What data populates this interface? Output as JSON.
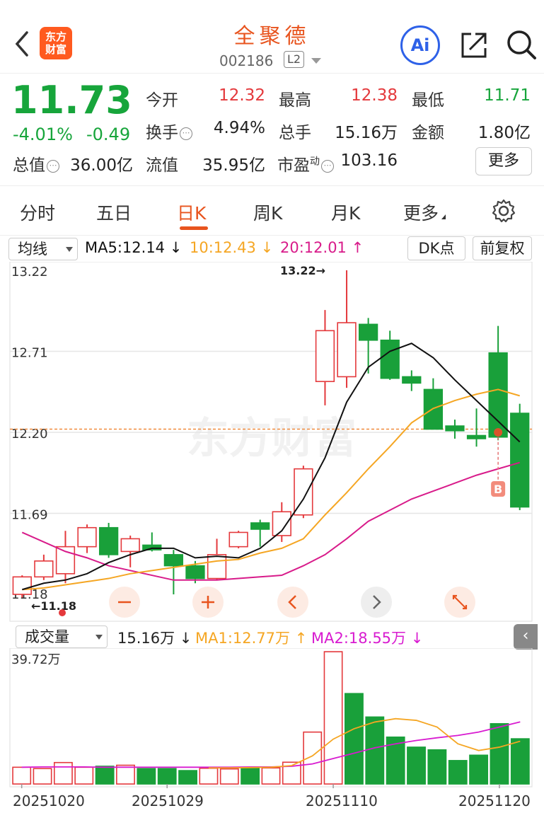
{
  "header": {
    "back_icon": "chevron-left-icon",
    "logo_text": "东方\n财富",
    "stock_name": "全聚德",
    "stock_code": "002186",
    "level_badge": "L2",
    "ai_label": "Ai"
  },
  "quote": {
    "price": "11.73",
    "change_pct": "-4.01%",
    "change_abs": "-0.49",
    "fields": [
      {
        "label": "今开",
        "value": "12.32",
        "color": "#e4393c"
      },
      {
        "label": "最高",
        "value": "12.38",
        "color": "#e4393c"
      },
      {
        "label": "最低",
        "value": "11.71",
        "color": "#17a53b"
      },
      {
        "label": "换手",
        "value": "4.94%",
        "color": "#222222"
      },
      {
        "label": "总手",
        "value": "15.16万",
        "color": "#222222"
      },
      {
        "label": "金额",
        "value": "1.80亿",
        "color": "#222222"
      },
      {
        "label": "总值",
        "value": "36.00亿",
        "color": "#222222"
      },
      {
        "label": "流值",
        "value": "35.95亿",
        "color": "#222222"
      },
      {
        "label": "市盈",
        "value": "103.16",
        "color": "#222222"
      }
    ],
    "pe_superscript": "动",
    "more_label": "更多"
  },
  "tabs": [
    {
      "label": "分时"
    },
    {
      "label": "五日"
    },
    {
      "label": "日K",
      "active": true
    },
    {
      "label": "周K"
    },
    {
      "label": "月K"
    },
    {
      "label": "更多"
    }
  ],
  "ma_bar": {
    "selector": "均线",
    "ma5": "MA5:12.14",
    "ma10": "10:12.43",
    "ma20": "20:12.01",
    "dk_label": "DK点",
    "adjust_label": "前复权",
    "colors": {
      "ma5": "#111111",
      "ma10": "#f5a623",
      "ma20": "#d81b8a"
    }
  },
  "price_axis": [
    "13.22",
    "12.71",
    "12.20",
    "11.69",
    "11.18"
  ],
  "annotations": {
    "high_marker": "13.22→",
    "low_marker": "←11.18",
    "buy_badge": "B",
    "watermark": "东方财富"
  },
  "volume_bar": {
    "selector": "成交量",
    "vol": "15.16万",
    "ma1": "MA1:12.77万",
    "ma2": "MA2:18.55万",
    "max_label": "39.72万"
  },
  "dates": [
    "20251020",
    "20251029",
    "20251110",
    "20251120"
  ],
  "chart_data": {
    "type": "candlestick",
    "ylim": [
      11.18,
      13.22
    ],
    "candles": [
      {
        "o": 11.18,
        "c": 11.29,
        "h": 11.3,
        "l": 11.16
      },
      {
        "o": 11.29,
        "c": 11.39,
        "h": 11.43,
        "l": 11.27
      },
      {
        "o": 11.31,
        "c": 11.48,
        "h": 11.58,
        "l": 11.25
      },
      {
        "o": 11.48,
        "c": 11.6,
        "h": 11.62,
        "l": 11.44
      },
      {
        "o": 11.6,
        "c": 11.43,
        "h": 11.63,
        "l": 11.41
      },
      {
        "o": 11.45,
        "c": 11.53,
        "h": 11.55,
        "l": 11.35
      },
      {
        "o": 11.49,
        "c": 11.46,
        "h": 11.57,
        "l": 11.45
      },
      {
        "o": 11.43,
        "c": 11.36,
        "h": 11.46,
        "l": 11.18
      },
      {
        "o": 11.36,
        "c": 11.28,
        "h": 11.39,
        "l": 11.25
      },
      {
        "o": 11.28,
        "c": 11.43,
        "h": 11.53,
        "l": 11.27
      },
      {
        "o": 11.48,
        "c": 11.57,
        "h": 11.58,
        "l": 11.47
      },
      {
        "o": 11.63,
        "c": 11.59,
        "h": 11.65,
        "l": 11.48
      },
      {
        "o": 11.55,
        "c": 11.7,
        "h": 11.76,
        "l": 11.51
      },
      {
        "o": 11.68,
        "c": 11.97,
        "h": 11.99,
        "l": 11.66
      },
      {
        "o": 12.52,
        "c": 12.84,
        "h": 12.97,
        "l": 12.37
      },
      {
        "o": 12.55,
        "c": 12.89,
        "h": 13.22,
        "l": 12.48
      },
      {
        "o": 12.88,
        "c": 12.78,
        "h": 12.92,
        "l": 12.57
      },
      {
        "o": 12.78,
        "c": 12.54,
        "h": 12.84,
        "l": 12.53
      },
      {
        "o": 12.55,
        "c": 12.51,
        "h": 12.59,
        "l": 12.46
      },
      {
        "o": 12.47,
        "c": 12.22,
        "h": 12.54,
        "l": 12.22
      },
      {
        "o": 12.24,
        "c": 12.21,
        "h": 12.28,
        "l": 12.16
      },
      {
        "o": 12.18,
        "c": 12.16,
        "h": 12.35,
        "l": 12.11
      },
      {
        "o": 12.7,
        "c": 12.17,
        "h": 12.87,
        "l": 12.15
      },
      {
        "o": 12.32,
        "c": 11.73,
        "h": 12.38,
        "l": 11.71
      }
    ],
    "ma5": [
      11.21,
      11.25,
      11.27,
      11.31,
      11.38,
      11.43,
      11.47,
      11.47,
      11.41,
      11.42,
      11.41,
      11.47,
      11.58,
      11.78,
      12.04,
      12.39,
      12.61,
      12.71,
      12.76,
      12.67,
      12.53,
      12.4,
      12.27,
      12.14
    ],
    "ma10": [
      11.21,
      11.22,
      11.24,
      11.26,
      11.28,
      11.31,
      11.33,
      11.35,
      11.37,
      11.39,
      11.4,
      11.44,
      11.47,
      11.53,
      11.68,
      11.82,
      11.97,
      12.11,
      12.26,
      12.35,
      12.4,
      12.44,
      12.47,
      12.43
    ],
    "ma20": [
      11.57,
      11.51,
      11.45,
      11.41,
      11.36,
      11.33,
      11.3,
      11.27,
      11.27,
      11.27,
      11.28,
      11.29,
      11.3,
      11.36,
      11.43,
      11.53,
      11.64,
      11.71,
      11.78,
      11.83,
      11.88,
      11.93,
      11.97,
      12.01
    ],
    "volume_ylim": [
      0,
      39.72
    ],
    "volume": [
      5.0,
      4.6,
      6.4,
      5.0,
      5.3,
      5.6,
      4.6,
      4.6,
      4.0,
      4.7,
      4.5,
      4.8,
      4.8,
      6.5,
      15.5,
      39.5,
      27.0,
      20.0,
      14.0,
      11.0,
      10.2,
      7.0,
      8.6,
      18.0,
      13.5
    ],
    "vol_ma1": [
      null,
      null,
      null,
      null,
      null,
      null,
      null,
      null,
      null,
      4.8,
      4.8,
      4.9,
      5.0,
      5.5,
      8.4,
      13.4,
      16.5,
      18.5,
      19.5,
      19.0,
      17.0,
      12.0,
      10.0,
      11.0,
      12.77
    ],
    "vol_ma2": [
      5.0,
      5.1,
      5.1,
      5.1,
      5.0,
      5.0,
      5.0,
      5.0,
      5.0,
      5.0,
      5.0,
      5.1,
      5.1,
      5.3,
      6.0,
      7.6,
      9.2,
      10.8,
      12.0,
      13.0,
      13.8,
      14.5,
      15.5,
      17.0,
      18.55
    ]
  }
}
